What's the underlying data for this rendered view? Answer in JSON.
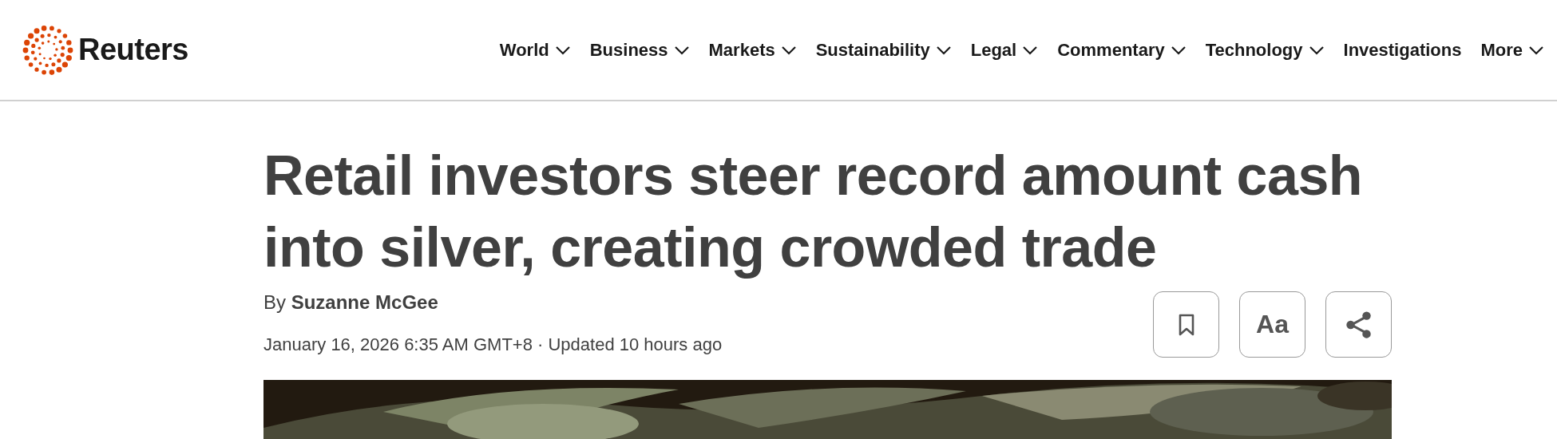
{
  "logo": {
    "text": "Reuters"
  },
  "nav": [
    {
      "label": "World",
      "dropdown": true
    },
    {
      "label": "Business",
      "dropdown": true
    },
    {
      "label": "Markets",
      "dropdown": true
    },
    {
      "label": "Sustainability",
      "dropdown": true
    },
    {
      "label": "Legal",
      "dropdown": true
    },
    {
      "label": "Commentary",
      "dropdown": true
    },
    {
      "label": "Technology",
      "dropdown": true
    },
    {
      "label": "Investigations",
      "dropdown": false
    },
    {
      "label": "More",
      "dropdown": true
    }
  ],
  "article": {
    "headline": "Retail investors steer record amount cash into silver, creating crowded trade",
    "byline_prefix": "By",
    "author": "Suzanne McGee",
    "dateline": "January 16, 2026 6:35 AM GMT+8 · Updated 10 hours ago",
    "actions": [
      {
        "kind": "bookmark"
      },
      {
        "kind": "text-size",
        "label": "Aa"
      },
      {
        "kind": "share"
      }
    ]
  }
}
